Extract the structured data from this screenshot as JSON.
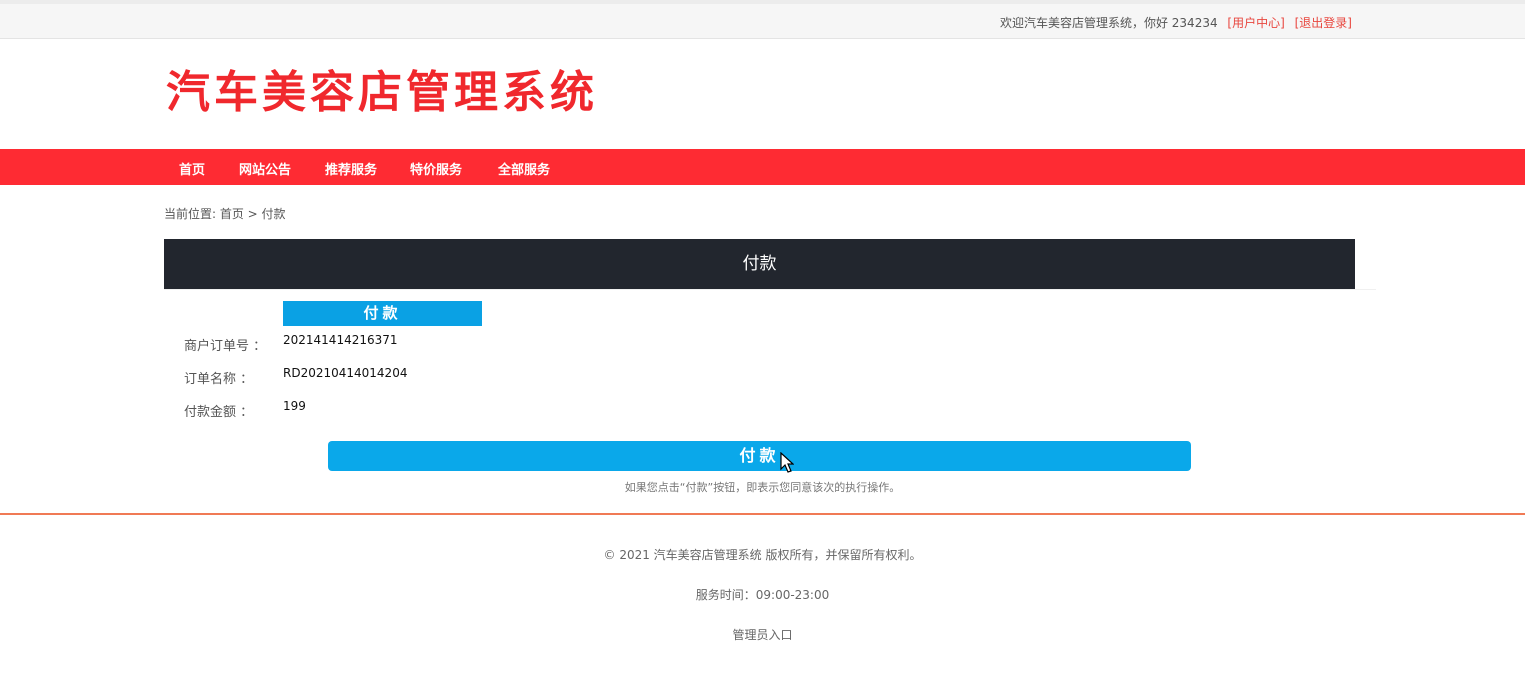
{
  "topbar": {
    "welcome": "欢迎汽车美容店管理系统，你好 234234",
    "user_center": "[用户中心]",
    "logout": "[退出登录]"
  },
  "logo": {
    "title": "汽车美容店管理系统"
  },
  "nav": {
    "items": [
      "首页",
      "网站公告",
      "推荐服务",
      "特价服务",
      "全部服务"
    ]
  },
  "breadcrumb": {
    "text": "当前位置: 首页 > 付款"
  },
  "panel": {
    "title": "付款"
  },
  "payment": {
    "header": "付款",
    "rows": [
      {
        "label": "商户订单号 ：",
        "value": "202141414216371"
      },
      {
        "label": "订单名称 ：",
        "value": "RD20210414014204"
      },
      {
        "label": "付款金额 ：",
        "value": "199"
      }
    ],
    "button_label": "付款",
    "note": "如果您点击“付款”按钮，即表示您同意该次的执行操作。"
  },
  "footer": {
    "copyright": "© 2021 汽车美容店管理系统 版权所有，并保留所有权利。",
    "service_hours": "服务时间：09:00-23:00",
    "admin_link": "管理员入口"
  },
  "colors": {
    "brand_red": "#fe2b33",
    "accent_blue": "#0aa8ea",
    "header_dark": "#22262e",
    "footer_line": "#f07a55"
  }
}
